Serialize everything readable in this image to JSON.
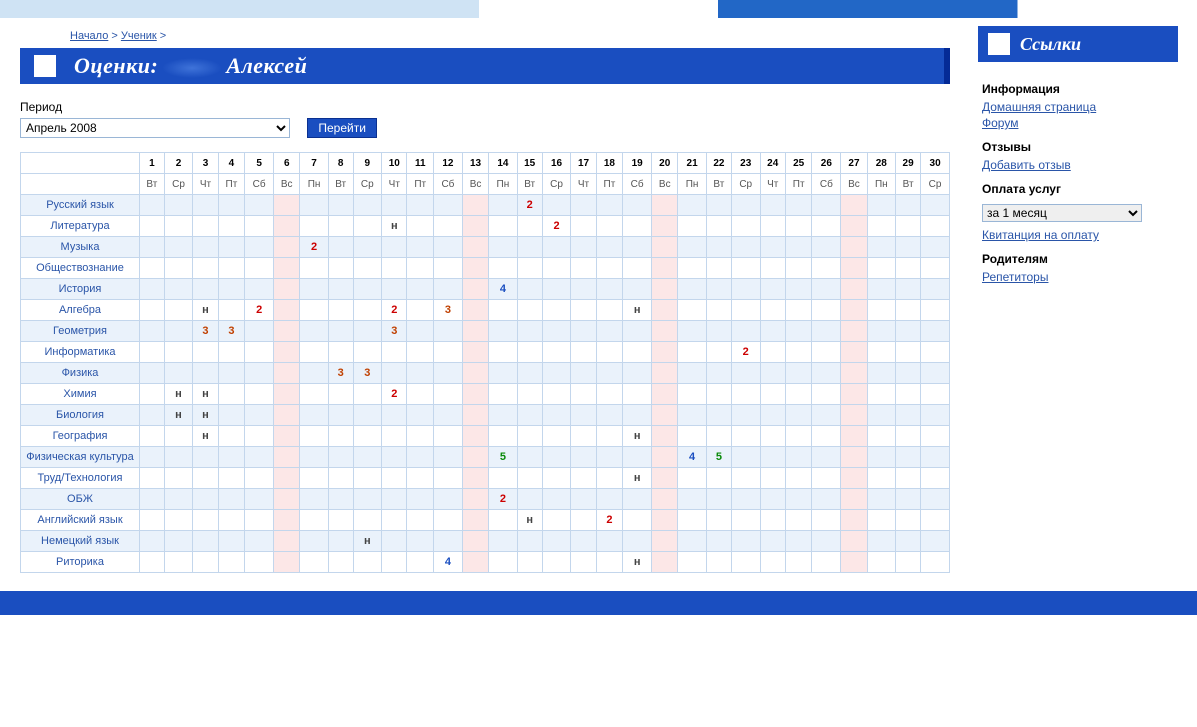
{
  "breadcrumb": [
    {
      "label": "Начало"
    },
    {
      "label": "Ученик"
    },
    {
      "label": ""
    }
  ],
  "page_title_prefix": "Оценки:",
  "student_name": "Алексей",
  "period_label": "Период",
  "period_value": "Апрель 2008",
  "go_button": "Перейти",
  "days": [
    1,
    2,
    3,
    4,
    5,
    6,
    7,
    8,
    9,
    10,
    11,
    12,
    13,
    14,
    15,
    16,
    17,
    18,
    19,
    20,
    21,
    22,
    23,
    24,
    25,
    26,
    27,
    28,
    29,
    30
  ],
  "weekdays": [
    "Вт",
    "Ср",
    "Чт",
    "Пт",
    "Сб",
    "Вс",
    "Пн",
    "Вт",
    "Ср",
    "Чт",
    "Пт",
    "Сб",
    "Вс",
    "Пн",
    "Вт",
    "Ср",
    "Чт",
    "Пт",
    "Сб",
    "Вс",
    "Пн",
    "Вт",
    "Ср",
    "Чт",
    "Пт",
    "Сб",
    "Вс",
    "Пн",
    "Вт",
    "Ср"
  ],
  "sundays": [
    6,
    13,
    20,
    27
  ],
  "subjects": [
    {
      "name": "Русский язык",
      "marks": {
        "15": "2"
      }
    },
    {
      "name": "Литература",
      "marks": {
        "10": "н",
        "16": "2"
      }
    },
    {
      "name": "Музыка",
      "marks": {
        "7": "2"
      }
    },
    {
      "name": "Обществознание",
      "marks": {}
    },
    {
      "name": "История",
      "marks": {
        "14": "4"
      }
    },
    {
      "name": "Алгебра",
      "marks": {
        "3": "н",
        "5": "2",
        "10": "2",
        "12": "3",
        "19": "н"
      }
    },
    {
      "name": "Геометрия",
      "marks": {
        "3": "3",
        "4": "3",
        "10": "3"
      }
    },
    {
      "name": "Информатика",
      "marks": {
        "23": "2"
      }
    },
    {
      "name": "Физика",
      "marks": {
        "8": "3",
        "9": "3"
      }
    },
    {
      "name": "Химия",
      "marks": {
        "2": "н",
        "3": "н",
        "10": "2"
      }
    },
    {
      "name": "Биология",
      "marks": {
        "2": "н",
        "3": "н"
      }
    },
    {
      "name": "География",
      "marks": {
        "3": "н",
        "19": "н"
      }
    },
    {
      "name": "Физическая культура",
      "marks": {
        "14": "5",
        "21": "4",
        "22": "5"
      }
    },
    {
      "name": "Труд/Технология",
      "marks": {
        "19": "н"
      }
    },
    {
      "name": "ОБЖ",
      "marks": {
        "14": "2"
      }
    },
    {
      "name": "Английский язык",
      "marks": {
        "15": "н",
        "18": "2"
      }
    },
    {
      "name": "Немецкий язык",
      "marks": {
        "9": "н"
      }
    },
    {
      "name": "Риторика",
      "marks": {
        "12": "4",
        "19": "н"
      }
    }
  ],
  "sidebar": {
    "title": "Ссылки",
    "sections": [
      {
        "title": "Информация",
        "links": [
          "Домашняя страница",
          "Форум"
        ]
      },
      {
        "title": "Отзывы",
        "links": [
          "Добавить отзыв"
        ]
      },
      {
        "title": "Оплата услуг",
        "select": "за 1 месяц",
        "links": [
          "Квитанция на оплату"
        ]
      },
      {
        "title": "Родителям",
        "links": [
          "Репетиторы"
        ]
      }
    ]
  }
}
